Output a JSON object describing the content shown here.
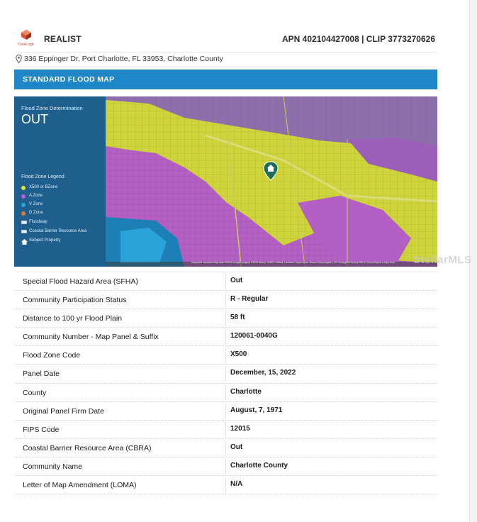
{
  "header": {
    "logo_text": "CoreLogic",
    "brand": "REALIST",
    "apn_clip": "APN 402104427008 | CLIP 3773270626"
  },
  "address": "336 Eppinger Dr, Port Charlotte, FL 33953, Charlotte County",
  "section_title": "STANDARD FLOOD MAP",
  "map": {
    "determination_label": "Flood Zone Determination",
    "determination_value": "OUT",
    "legend_title": "Flood Zone Legend",
    "legend": [
      {
        "label": "X500 or BZone",
        "color": "#e8e230",
        "icon": "dot"
      },
      {
        "label": "A Zone",
        "color": "#c25bd6",
        "icon": "dot"
      },
      {
        "label": "V Zone",
        "color": "#1fa8e0",
        "icon": "dot"
      },
      {
        "label": "D Zone",
        "color": "#e07a3a",
        "icon": "dot"
      },
      {
        "label": "Floodway",
        "color": "#e9eef3",
        "icon": "rect"
      },
      {
        "label": "Coastal Barrier Resource Area",
        "color": "#e9eef3",
        "icon": "rect"
      },
      {
        "label": "Subject Property",
        "color": "#ffffff",
        "icon": "house-icon"
      }
    ],
    "footer_text": "Keyboard shortcuts  Map data ©2023 Google Imagery ©2023 Airbus, CNES / Airbus, Landsat / Copernicus, Maxar Technologies, U.S. Geological Survey  100 m  Terms  Report a map error",
    "watermark": "StellarMLS"
  },
  "details": [
    {
      "key": "Special Flood Hazard Area (SFHA)",
      "value": "Out"
    },
    {
      "key": "Community Participation Status",
      "value": "R - Regular"
    },
    {
      "key": "Distance to 100 yr Flood Plain",
      "value": "58 ft"
    },
    {
      "key": "Community Number - Map Panel & Suffix",
      "value": "120061-0040G"
    },
    {
      "key": "Flood Zone Code",
      "value": "X500"
    },
    {
      "key": "Panel Date",
      "value": "December, 15, 2022"
    },
    {
      "key": "County",
      "value": "Charlotte"
    },
    {
      "key": "Original Panel Firm Date",
      "value": "August, 7, 1971"
    },
    {
      "key": "FIPS Code",
      "value": "12015"
    },
    {
      "key": "Coastal Barrier Resource Area (CBRA)",
      "value": "Out"
    },
    {
      "key": "Community Name",
      "value": "Charlotte County"
    },
    {
      "key": "Letter of Map Amendment (LOMA)",
      "value": "N/A"
    }
  ]
}
